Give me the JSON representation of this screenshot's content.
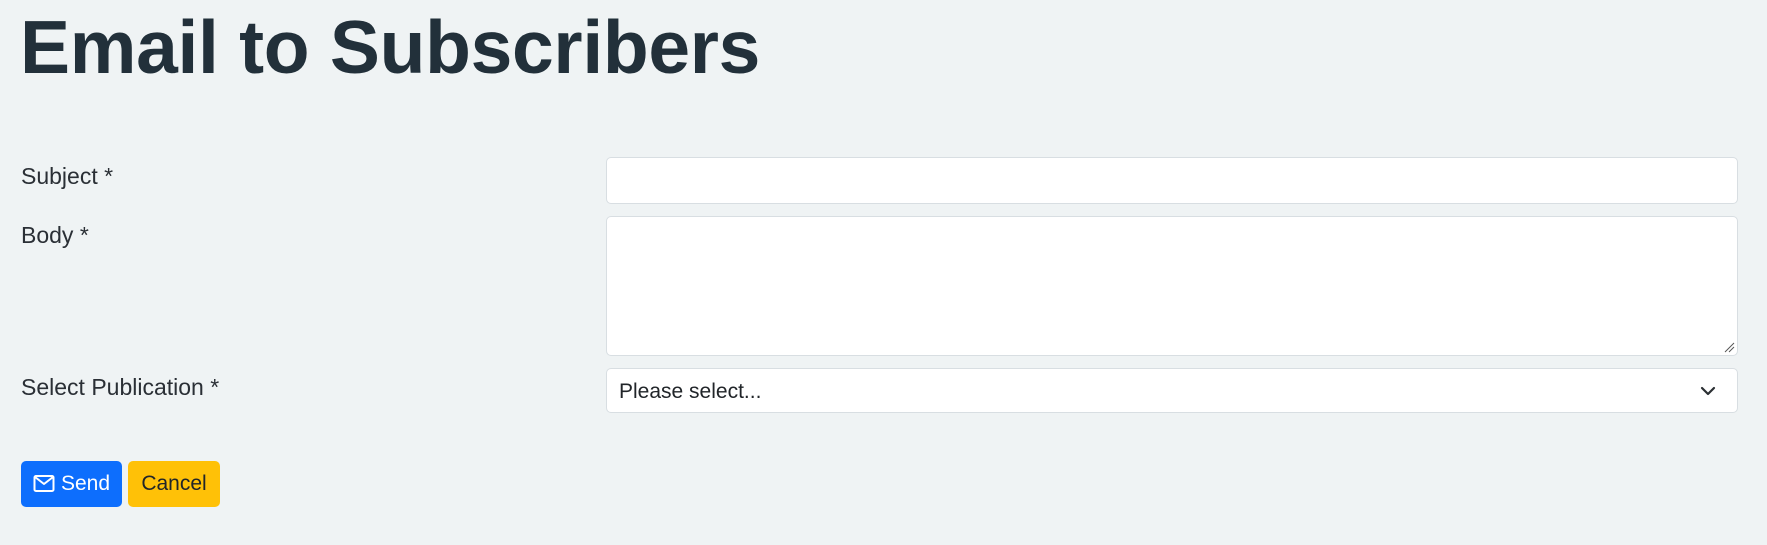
{
  "page": {
    "title": "Email to Subscribers"
  },
  "form": {
    "subject_label": "Subject *",
    "subject_value": "",
    "body_label": "Body *",
    "body_value": "",
    "publication_label": "Select Publication *",
    "publication_selected": "Please select..."
  },
  "actions": {
    "send_label": "Send",
    "send_icon": "envelope-icon",
    "cancel_label": "Cancel"
  },
  "colors": {
    "background": "#eff3f4",
    "primary": "#0d6efd",
    "warning": "#ffc107",
    "title": "#22303a"
  }
}
